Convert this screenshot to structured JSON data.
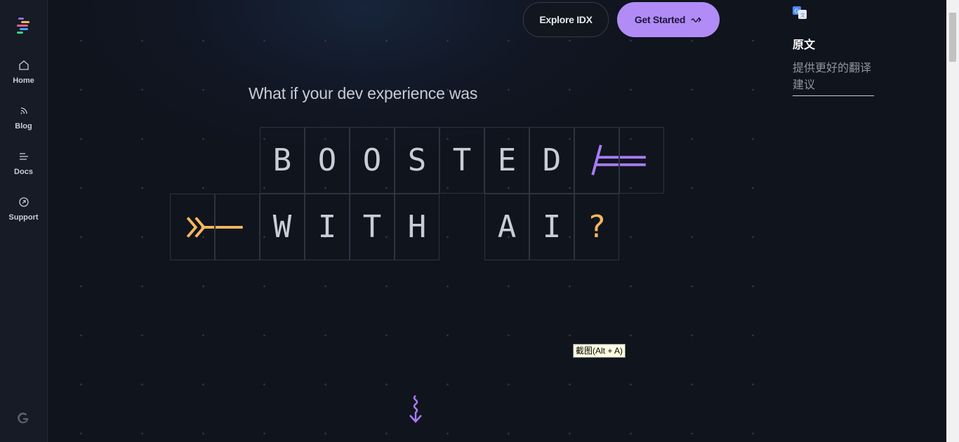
{
  "sidebar": {
    "items": [
      {
        "label": "Home",
        "icon": "home-icon"
      },
      {
        "label": "Blog",
        "icon": "rss-icon"
      },
      {
        "label": "Docs",
        "icon": "docs-icon"
      },
      {
        "label": "Support",
        "icon": "support-icon"
      }
    ],
    "logo": "idx-logo",
    "footer_logo": "google-g-logo"
  },
  "header": {
    "explore_label": "Explore IDX",
    "get_started_label": "Get Started",
    "get_started_icon": "squiggle-arrow-icon"
  },
  "hero": {
    "headline": "What if your dev experience was",
    "row1": [
      "B",
      "O",
      "O",
      "S",
      "T",
      "E",
      "D"
    ],
    "row2_word1": [
      "W",
      "I",
      "T",
      "H"
    ],
    "row2_word2": [
      "A",
      "I"
    ],
    "question_mark": "?",
    "accent_purple": "#a77cf2",
    "accent_orange": "#f6b75c"
  },
  "translate_widget": {
    "title": "原文",
    "prompt": "提供更好的翻译建议"
  },
  "tooltip": "截图(Alt + A)"
}
